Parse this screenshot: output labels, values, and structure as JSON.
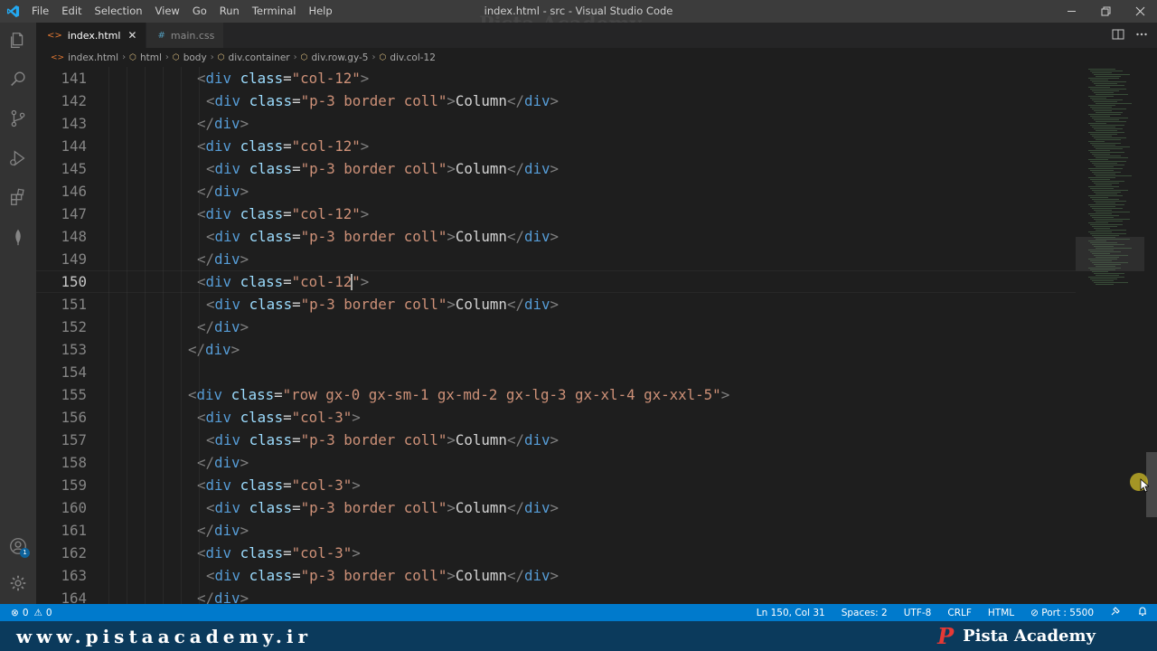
{
  "window": {
    "title": "index.html - src - Visual Studio Code",
    "watermark": "Pista Academy",
    "menu": [
      "File",
      "Edit",
      "Selection",
      "View",
      "Go",
      "Run",
      "Terminal",
      "Help"
    ],
    "controls": {
      "minimize": "—",
      "restore": "❐",
      "close": "✕"
    }
  },
  "tabs": [
    {
      "label": "index.html",
      "icon": "html-file-icon",
      "active": true,
      "close": "✕"
    },
    {
      "label": "main.css",
      "icon": "css-file-icon",
      "active": false,
      "hash": "#"
    }
  ],
  "breadcrumbs": [
    "index.html",
    "html",
    "body",
    "div.container",
    "div.row.gy-5",
    "div.col-12"
  ],
  "editor": {
    "lines": [
      {
        "n": "141",
        "indent": 10,
        "kind": "open",
        "cls": "col-12"
      },
      {
        "n": "142",
        "indent": 11,
        "kind": "inner",
        "cls": "p-3 border coll",
        "text": "Column"
      },
      {
        "n": "143",
        "indent": 10,
        "kind": "close"
      },
      {
        "n": "144",
        "indent": 10,
        "kind": "open",
        "cls": "col-12"
      },
      {
        "n": "145",
        "indent": 11,
        "kind": "inner",
        "cls": "p-3 border coll",
        "text": "Column"
      },
      {
        "n": "146",
        "indent": 10,
        "kind": "close"
      },
      {
        "n": "147",
        "indent": 10,
        "kind": "open",
        "cls": "col-12"
      },
      {
        "n": "148",
        "indent": 11,
        "kind": "inner",
        "cls": "p-3 border coll",
        "text": "Column"
      },
      {
        "n": "149",
        "indent": 10,
        "kind": "close"
      },
      {
        "n": "150",
        "indent": 10,
        "kind": "open",
        "cls": "col-12",
        "current": true
      },
      {
        "n": "151",
        "indent": 11,
        "kind": "inner",
        "cls": "p-3 border coll",
        "text": "Column"
      },
      {
        "n": "152",
        "indent": 10,
        "kind": "close"
      },
      {
        "n": "153",
        "indent": 9,
        "kind": "close"
      },
      {
        "n": "154",
        "indent": 0,
        "kind": "blank"
      },
      {
        "n": "155",
        "indent": 9,
        "kind": "open",
        "cls": "row gx-0 gx-sm-1 gx-md-2 gx-lg-3 gx-xl-4 gx-xxl-5"
      },
      {
        "n": "156",
        "indent": 10,
        "kind": "open",
        "cls": "col-3"
      },
      {
        "n": "157",
        "indent": 11,
        "kind": "inner",
        "cls": "p-3 border coll",
        "text": "Column"
      },
      {
        "n": "158",
        "indent": 10,
        "kind": "close"
      },
      {
        "n": "159",
        "indent": 10,
        "kind": "open",
        "cls": "col-3"
      },
      {
        "n": "160",
        "indent": 11,
        "kind": "inner",
        "cls": "p-3 border coll",
        "text": "Column"
      },
      {
        "n": "161",
        "indent": 10,
        "kind": "close"
      },
      {
        "n": "162",
        "indent": 10,
        "kind": "open",
        "cls": "col-3"
      },
      {
        "n": "163",
        "indent": 11,
        "kind": "inner",
        "cls": "p-3 border coll",
        "text": "Column"
      },
      {
        "n": "164",
        "indent": 10,
        "kind": "close"
      }
    ]
  },
  "statusbar": {
    "errors": "0",
    "warnings": "0",
    "position": "Ln 150, Col 31",
    "spaces": "Spaces: 2",
    "encoding": "UTF-8",
    "eol": "CRLF",
    "language": "HTML",
    "port": "Port : 5500"
  },
  "brand": {
    "url": "www.pistaacademy.ir",
    "name": "Pista Academy",
    "logo": "P"
  },
  "colors": {
    "accent": "#007acc",
    "brand_bar": "#0b3a5c",
    "tag_name": "#569cd6",
    "attribute": "#9cdcfe",
    "string": "#ce9178"
  }
}
